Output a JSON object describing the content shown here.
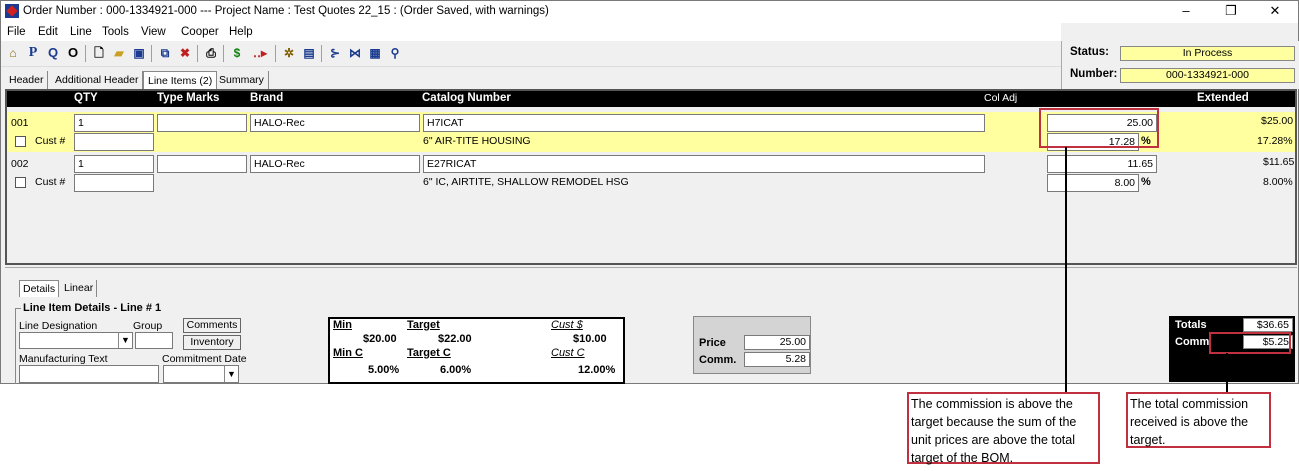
{
  "window": {
    "title": "Order Number : 000-1334921-000 --- Project Name : Test Quotes 22_15 : (Order Saved, with warnings)",
    "minimize": "–",
    "restore": "❐",
    "close": "✕"
  },
  "menu": [
    "File",
    "Edit",
    "Line",
    "Tools",
    "View",
    "Cooper",
    "Help"
  ],
  "toolbar": {
    "p_label": "P",
    "q_label": "Q",
    "o_label": "O",
    "dollar_label": "$"
  },
  "status": {
    "status_label": "Status:",
    "status_value": "In Process",
    "number_label": "Number:",
    "number_value": "000-1334921-000"
  },
  "tabs": [
    "Header",
    "Additional Header",
    "Line Items (2)",
    "Summary"
  ],
  "grid": {
    "headers": {
      "qty": "QTY",
      "type_marks": "Type Marks",
      "brand": "Brand",
      "catalog": "Catalog Number",
      "col_adj": "Col Adj",
      "extended": "Extended"
    },
    "rows": [
      {
        "line": "001",
        "qty": "1",
        "type_marks": "",
        "brand": "HALO-Rec",
        "catalog": "H7ICAT",
        "description": "6\" AIR-TITE HOUSING",
        "price": "25.00",
        "comm_pct": "17.28",
        "extended": "$25.00",
        "extended_pct": "17.28%",
        "cust_label": "Cust #"
      },
      {
        "line": "002",
        "qty": "1",
        "type_marks": "",
        "brand": "HALO-Rec",
        "catalog": "E27RICAT",
        "description": "6\" IC, AIRTITE, SHALLOW REMODEL HSG",
        "price": "11.65",
        "comm_pct": "8.00",
        "extended": "$11.65",
        "extended_pct": "8.00%",
        "cust_label": "Cust #"
      }
    ],
    "pct_sign": "%"
  },
  "details": {
    "tabs": [
      "Details",
      "Linear"
    ],
    "group_title": "Line Item Details - Line # 1",
    "line_designation": "Line Designation",
    "group": "Group",
    "comments_btn": "Comments",
    "inventory_btn": "Inventory",
    "manufacturing_text": "Manufacturing Text",
    "commitment_date": "Commitment Date"
  },
  "targets": {
    "min_label": "Min",
    "target_label": "Target",
    "cust_label": "Cust $",
    "min_value": "$20.00",
    "target_value": "$22.00",
    "cust_value": "$10.00",
    "minc_label": "Min C",
    "targetc_label": "Target C",
    "custc_label": "Cust C",
    "minc_value": "5.00%",
    "targetc_value": "6.00%",
    "custc_value": "12.00%"
  },
  "pricebox": {
    "price_label": "Price",
    "price_value": "25.00",
    "comm_label": "Comm.",
    "comm_value": "5.28"
  },
  "totals": {
    "totals_label": "Totals",
    "totals_value": "$36.65",
    "comm_label": "Comm",
    "comm_value": "$5.25"
  },
  "callouts": {
    "left": "The commission is above the target because the sum of the unit prices are above the total target of the BOM.",
    "right": "The total commission received is above the target."
  },
  "colors": {
    "highlight_row": "#ffffa0",
    "callout_border": "#c0303f",
    "header_bg": "#000000"
  }
}
